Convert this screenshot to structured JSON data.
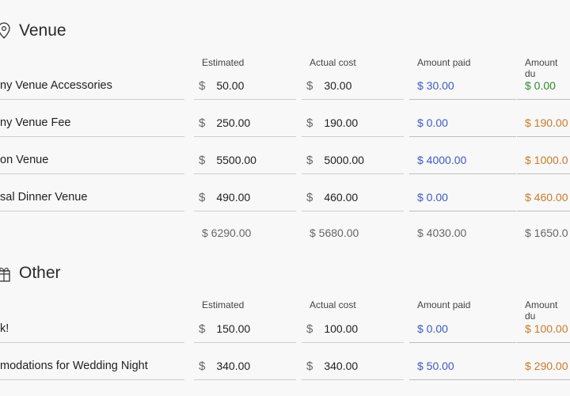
{
  "venue": {
    "title": "Venue",
    "headers": {
      "estimated": "Estimated",
      "actual": "Actual cost",
      "paid": "Amount paid",
      "due": "Amount du"
    },
    "rows": [
      {
        "name": "ny Venue Accessories",
        "currency": "$",
        "estimated": "50.00",
        "actual": "30.00",
        "paid": "$ 30.00",
        "due": "$ 0.00"
      },
      {
        "name": "ny Venue Fee",
        "currency": "$",
        "estimated": "250.00",
        "actual": "190.00",
        "paid": "$ 0.00",
        "due": "$ 190.00"
      },
      {
        "name": "on Venue",
        "currency": "$",
        "estimated": "5500.00",
        "actual": "5000.00",
        "paid": "$ 4000.00",
        "due": "$ 1000.0"
      },
      {
        "name": "sal Dinner Venue",
        "currency": "$",
        "estimated": "490.00",
        "actual": "460.00",
        "paid": "$ 0.00",
        "due": "$ 460.00"
      }
    ],
    "totals": {
      "estimated": "$ 6290.00",
      "actual": "$ 5680.00",
      "paid": "$ 4030.00",
      "due": "$ 1650.0"
    }
  },
  "other": {
    "title": "Other",
    "headers": {
      "estimated": "Estimated",
      "actual": "Actual cost",
      "paid": "Amount paid",
      "due": "Amount du"
    },
    "rows": [
      {
        "name": "k!",
        "currency": "$",
        "estimated": "150.00",
        "actual": "100.00",
        "paid": "$ 0.00",
        "due": "$ 100.00"
      },
      {
        "name": "modations for Wedding Night",
        "currency": "$",
        "estimated": "340.00",
        "actual": "340.00",
        "paid": "$ 50.00",
        "due": "$ 290.00"
      }
    ]
  },
  "colors": {
    "paid": "#3b5bc4",
    "due_zero": "#2e8b2e",
    "due_outstanding": "#c87a2a"
  },
  "icons": {
    "venue": "map-pin-icon",
    "other": "gift-box-icon"
  }
}
